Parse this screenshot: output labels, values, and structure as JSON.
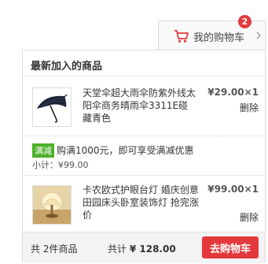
{
  "header": {
    "cart_label": "我的购物车",
    "cart_badge": "2",
    "accent_color": "#e4393c"
  },
  "panel": {
    "title": "最新加入的商品"
  },
  "items": [
    {
      "name": "天堂伞超大雨伞防紫外线太阳伞商务晴雨伞3311E碰 藏青色",
      "price": "¥29.00×1",
      "delete_label": "删除",
      "image_icon": "umbrella-icon"
    },
    {
      "name": "卡农欧式护眼台灯 婚庆创意田园床头卧室装饰灯 抢完涨价",
      "price": "¥99.00×1",
      "delete_label": "删除",
      "image_icon": "lamp-icon"
    }
  ],
  "promotion": {
    "tag": "满减",
    "text": "购满1000元，即可享受满减优惠",
    "subtotal": "小计：¥99.00",
    "tag_color": "#4caf2a"
  },
  "footer": {
    "count_text": "共 2件商品",
    "total_label": "共计",
    "total_value": "¥ 128.00",
    "checkout_label": "去购物车"
  }
}
